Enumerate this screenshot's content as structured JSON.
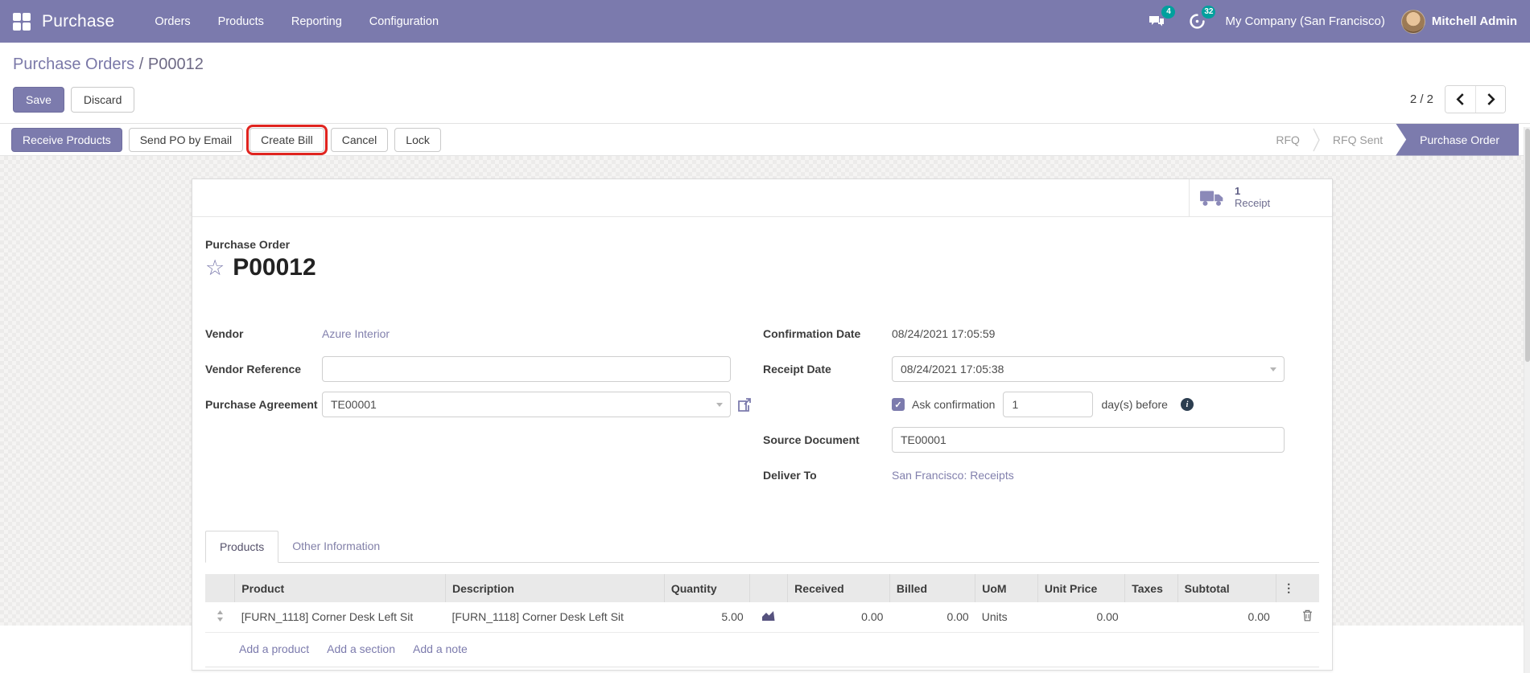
{
  "nav": {
    "app": "Purchase",
    "menus": {
      "orders": "Orders",
      "products": "Products",
      "reporting": "Reporting",
      "configuration": "Configuration"
    },
    "messages_badge": "4",
    "activity_badge": "32",
    "company": "My Company (San Francisco)",
    "user": "Mitchell Admin"
  },
  "breadcrumb": {
    "link": "Purchase Orders",
    "sep": "/",
    "current": "P00012"
  },
  "control_panel": {
    "save": "Save",
    "discard": "Discard",
    "pager": "2 / 2"
  },
  "statusbar": {
    "receive_products": "Receive Products",
    "send_po_by_email": "Send PO by Email",
    "create_bill": "Create Bill",
    "cancel": "Cancel",
    "lock": "Lock",
    "steps": {
      "rfq": "RFQ",
      "rfq_sent": "RFQ Sent",
      "purchase_order": "Purchase Order"
    }
  },
  "sheet": {
    "stat": {
      "value": "1",
      "label": "Receipt"
    },
    "doc_type": "Purchase Order",
    "doc_name": "P00012",
    "fields": {
      "vendor": {
        "label": "Vendor",
        "value": "Azure Interior"
      },
      "vendor_reference": {
        "label": "Vendor Reference",
        "value": ""
      },
      "purchase_agreement": {
        "label": "Purchase Agreement",
        "value": "TE00001"
      },
      "confirmation_date": {
        "label": "Confirmation Date",
        "value": "08/24/2021 17:05:59"
      },
      "receipt_date": {
        "label": "Receipt Date",
        "value": "08/24/2021 17:05:38"
      },
      "ask_confirmation": {
        "label": "Ask confirmation",
        "value": "1",
        "suffix": "day(s) before"
      },
      "source_document": {
        "label": "Source Document",
        "value": "TE00001"
      },
      "deliver_to": {
        "label": "Deliver To",
        "value": "San Francisco: Receipts"
      }
    },
    "tabs": {
      "products": "Products",
      "other_information": "Other Information"
    },
    "table": {
      "headers": {
        "product": "Product",
        "description": "Description",
        "quantity": "Quantity",
        "received": "Received",
        "billed": "Billed",
        "uom": "UoM",
        "unit_price": "Unit Price",
        "taxes": "Taxes",
        "subtotal": "Subtotal",
        "menu": "⋮"
      },
      "rows": [
        {
          "product": "[FURN_1118] Corner Desk Left Sit",
          "description": "[FURN_1118] Corner Desk Left Sit",
          "quantity": "5.00",
          "received": "0.00",
          "billed": "0.00",
          "uom": "Units",
          "unit_price": "0.00",
          "taxes": "",
          "subtotal": "0.00"
        }
      ],
      "links": {
        "add_product": "Add a product",
        "add_section": "Add a section",
        "add_note": "Add a note"
      }
    }
  },
  "colors": {
    "primary": "#7c7bad",
    "badge_teal": "#00a09d",
    "highlight_red": "#e0241f"
  }
}
